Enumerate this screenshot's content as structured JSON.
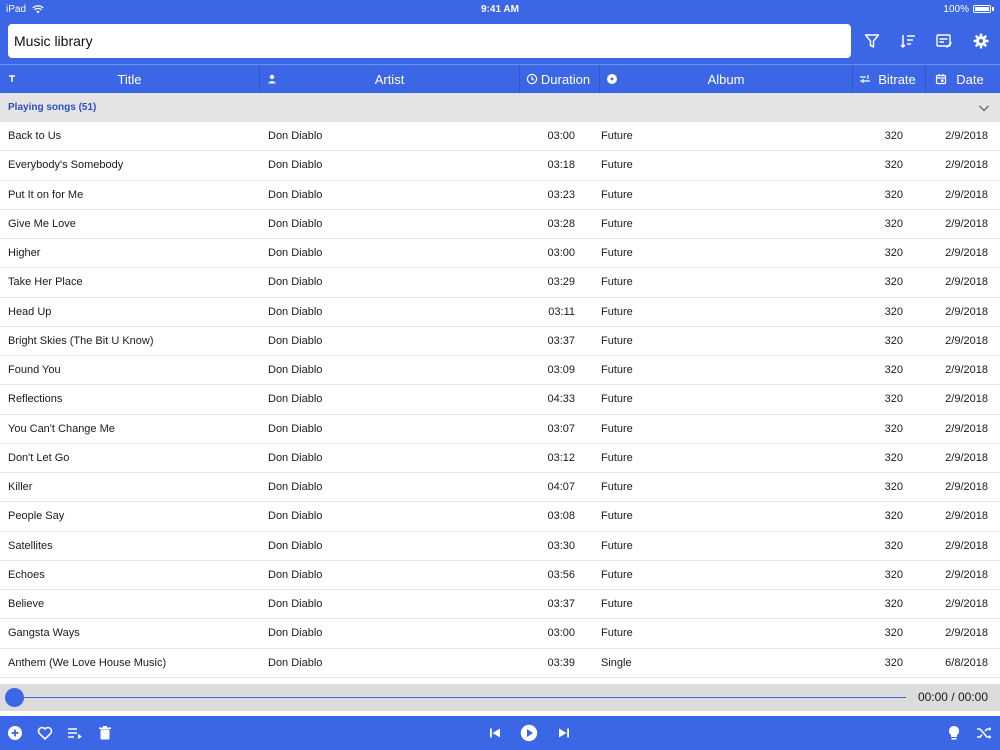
{
  "status_bar": {
    "device": "iPad",
    "time": "9:41 AM",
    "battery": "100%"
  },
  "header": {
    "title_value": "Music library",
    "tools": [
      "filter-icon",
      "sort-icon",
      "edit-list-icon",
      "settings-gear-icon"
    ]
  },
  "columns": [
    {
      "key": "title",
      "label": "Title",
      "icon": "text-t-icon"
    },
    {
      "key": "artist",
      "label": "Artist",
      "icon": "person-icon"
    },
    {
      "key": "duration",
      "label": "Duration",
      "icon": "clock-icon"
    },
    {
      "key": "album",
      "label": "Album",
      "icon": "disc-icon"
    },
    {
      "key": "bitrate",
      "label": "Bitrate",
      "icon": "bitrate-icon"
    },
    {
      "key": "date",
      "label": "Date",
      "icon": "calendar-icon"
    }
  ],
  "group": {
    "label": "Playing songs (51)",
    "icon": "chevron-down-icon"
  },
  "songs": [
    {
      "title": "Back to Us",
      "artist": "Don Diablo",
      "duration": "03:00",
      "album": "Future",
      "bitrate": "320",
      "date": "2/9/2018"
    },
    {
      "title": "Everybody's Somebody",
      "artist": "Don Diablo",
      "duration": "03:18",
      "album": "Future",
      "bitrate": "320",
      "date": "2/9/2018"
    },
    {
      "title": "Put It on for Me",
      "artist": "Don Diablo",
      "duration": "03:23",
      "album": "Future",
      "bitrate": "320",
      "date": "2/9/2018"
    },
    {
      "title": "Give Me Love",
      "artist": "Don Diablo",
      "duration": "03:28",
      "album": "Future",
      "bitrate": "320",
      "date": "2/9/2018"
    },
    {
      "title": "Higher",
      "artist": "Don Diablo",
      "duration": "03:00",
      "album": "Future",
      "bitrate": "320",
      "date": "2/9/2018"
    },
    {
      "title": "Take Her Place",
      "artist": "Don Diablo",
      "duration": "03:29",
      "album": "Future",
      "bitrate": "320",
      "date": "2/9/2018"
    },
    {
      "title": "Head Up",
      "artist": "Don Diablo",
      "duration": "03:11",
      "album": "Future",
      "bitrate": "320",
      "date": "2/9/2018"
    },
    {
      "title": "Bright Skies (The Bit U Know)",
      "artist": "Don Diablo",
      "duration": "03:37",
      "album": "Future",
      "bitrate": "320",
      "date": "2/9/2018"
    },
    {
      "title": "Found You",
      "artist": "Don Diablo",
      "duration": "03:09",
      "album": "Future",
      "bitrate": "320",
      "date": "2/9/2018"
    },
    {
      "title": "Reflections",
      "artist": "Don Diablo",
      "duration": "04:33",
      "album": "Future",
      "bitrate": "320",
      "date": "2/9/2018"
    },
    {
      "title": "You Can't Change Me",
      "artist": "Don Diablo",
      "duration": "03:07",
      "album": "Future",
      "bitrate": "320",
      "date": "2/9/2018"
    },
    {
      "title": "Don't Let Go",
      "artist": "Don Diablo",
      "duration": "03:12",
      "album": "Future",
      "bitrate": "320",
      "date": "2/9/2018"
    },
    {
      "title": "Killer",
      "artist": "Don Diablo",
      "duration": "04:07",
      "album": "Future",
      "bitrate": "320",
      "date": "2/9/2018"
    },
    {
      "title": "People Say",
      "artist": "Don Diablo",
      "duration": "03:08",
      "album": "Future",
      "bitrate": "320",
      "date": "2/9/2018"
    },
    {
      "title": "Satellites",
      "artist": "Don Diablo",
      "duration": "03:30",
      "album": "Future",
      "bitrate": "320",
      "date": "2/9/2018"
    },
    {
      "title": "Echoes",
      "artist": "Don Diablo",
      "duration": "03:56",
      "album": "Future",
      "bitrate": "320",
      "date": "2/9/2018"
    },
    {
      "title": "Believe",
      "artist": "Don Diablo",
      "duration": "03:37",
      "album": "Future",
      "bitrate": "320",
      "date": "2/9/2018"
    },
    {
      "title": "Gangsta Ways",
      "artist": "Don Diablo",
      "duration": "03:00",
      "album": "Future",
      "bitrate": "320",
      "date": "2/9/2018"
    },
    {
      "title": "Anthem (We Love House Music)",
      "artist": "Don Diablo",
      "duration": "03:39",
      "album": "Single",
      "bitrate": "320",
      "date": "6/8/2018"
    }
  ],
  "player": {
    "time_readout": "00:00 / 00:00",
    "progress": 0
  },
  "bottom_bar": {
    "left_icons": [
      "add-circle-icon",
      "heart-icon",
      "queue-list-icon",
      "trash-icon"
    ],
    "center_icons": [
      "skip-previous-icon",
      "play-circle-icon",
      "skip-next-icon"
    ],
    "right_icons": [
      "lightbulb-icon",
      "shuffle-icon"
    ]
  },
  "colors": {
    "accent": "#3b66e6",
    "group_background": "#e4e4e4",
    "group_text": "#2c4fbf",
    "player_background": "#dcdcdc"
  }
}
